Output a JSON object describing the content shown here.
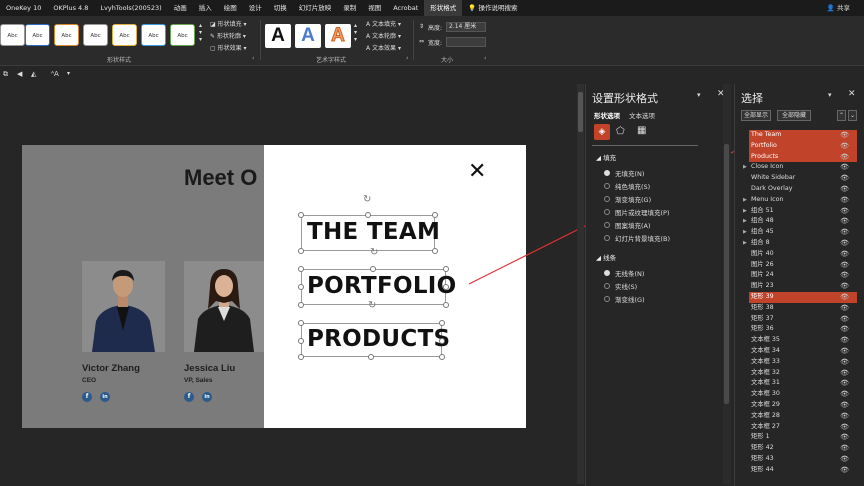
{
  "tabs": [
    "OneKey 10",
    "OKPlus 4.8",
    "LvyhTools(200523)",
    "动画",
    "插入",
    "绘图",
    "设计",
    "切换",
    "幻灯片放映",
    "录制",
    "视图",
    "Acrobat",
    "形状格式"
  ],
  "tell_me": "操作说明搜索",
  "share": "共享",
  "ribbon": {
    "thumb_text": "Abc",
    "shape_fill": "形状填充",
    "shape_outline": "形状轮廓",
    "shape_effect": "形状效果",
    "shape_styles_label": "形状样式",
    "text_fill": "文本填充",
    "text_outline": "文本轮廓",
    "text_effect": "文本效果",
    "wordart_label": "艺术字样式",
    "art_letter": "A",
    "height_label": "高度:",
    "height_value": "2.14 厘米",
    "width_label": "宽度:",
    "size_label": "大小"
  },
  "slide": {
    "heading": "Meet O",
    "close": "✕",
    "people": [
      {
        "name": "Victor Zhang",
        "role": "CEO"
      },
      {
        "name": "Jessica Liu",
        "role": "VP, Sales"
      }
    ],
    "menu": [
      "THE TEAM",
      "PORTFOLIO",
      "PRODUCTS"
    ],
    "social_f": "f",
    "social_in": "in"
  },
  "format_pane": {
    "title": "设置形状格式",
    "tab_shape": "形状选项",
    "tab_text": "文本选项",
    "fill_title": "填充",
    "fill_options": [
      "无填充(N)",
      "纯色填充(S)",
      "渐变填充(G)",
      "图片或纹理填充(P)",
      "图案填充(A)",
      "幻灯片背景填充(B)"
    ],
    "line_title": "线条",
    "line_options": [
      "无线条(N)",
      "实线(S)",
      "渐变线(G)"
    ]
  },
  "selection_pane": {
    "title": "选择",
    "show_all": "全部显示",
    "hide_all": "全部隐藏",
    "items": [
      {
        "label": "The Team",
        "highlight": true,
        "expand": false
      },
      {
        "label": "Portfolio",
        "highlight": true,
        "expand": false
      },
      {
        "label": "Products",
        "highlight": true,
        "expand": false
      },
      {
        "label": "Close Icon",
        "highlight": false,
        "expand": true
      },
      {
        "label": "White Sidebar",
        "highlight": false,
        "expand": false
      },
      {
        "label": "Dark Overlay",
        "highlight": false,
        "expand": false
      },
      {
        "label": "Menu Icon",
        "highlight": false,
        "expand": true
      },
      {
        "label": "组合 51",
        "highlight": false,
        "expand": true
      },
      {
        "label": "组合 48",
        "highlight": false,
        "expand": true
      },
      {
        "label": "组合 45",
        "highlight": false,
        "expand": true
      },
      {
        "label": "组合 8",
        "highlight": false,
        "expand": true
      },
      {
        "label": "图片 40",
        "highlight": false,
        "expand": false
      },
      {
        "label": "图片 26",
        "highlight": false,
        "expand": false
      },
      {
        "label": "图片 24",
        "highlight": false,
        "expand": false
      },
      {
        "label": "图片 23",
        "highlight": false,
        "expand": false
      },
      {
        "label": "矩形 39",
        "highlight": true,
        "expand": false
      },
      {
        "label": "矩形 38",
        "highlight": false,
        "expand": false
      },
      {
        "label": "矩形 37",
        "highlight": false,
        "expand": false
      },
      {
        "label": "矩形 36",
        "highlight": false,
        "expand": false
      },
      {
        "label": "文本框 35",
        "highlight": false,
        "expand": false
      },
      {
        "label": "文本框 34",
        "highlight": false,
        "expand": false
      },
      {
        "label": "文本框 33",
        "highlight": false,
        "expand": false
      },
      {
        "label": "文本框 32",
        "highlight": false,
        "expand": false
      },
      {
        "label": "文本框 31",
        "highlight": false,
        "expand": false
      },
      {
        "label": "文本框 30",
        "highlight": false,
        "expand": false
      },
      {
        "label": "文本框 29",
        "highlight": false,
        "expand": false
      },
      {
        "label": "文本框 28",
        "highlight": false,
        "expand": false
      },
      {
        "label": "文本框 27",
        "highlight": false,
        "expand": false
      },
      {
        "label": "矩形 1",
        "highlight": false,
        "expand": false
      },
      {
        "label": "矩形 42",
        "highlight": false,
        "expand": false
      },
      {
        "label": "矩形 43",
        "highlight": false,
        "expand": false
      },
      {
        "label": "矩形 44",
        "highlight": false,
        "expand": false
      }
    ]
  },
  "colors": {
    "accent": "#c0432a",
    "arrow": "#e03030"
  }
}
